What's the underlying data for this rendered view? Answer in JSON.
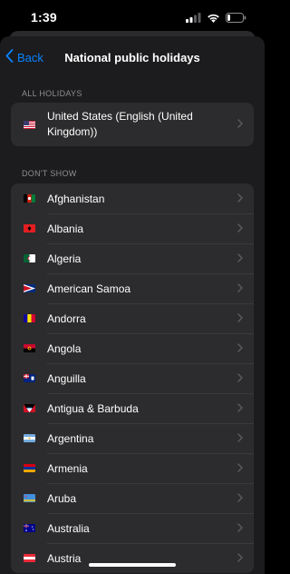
{
  "status_bar": {
    "time": "1:39"
  },
  "nav": {
    "back_label": "Back",
    "title": "National public holidays"
  },
  "sections": {
    "all_holidays": {
      "header": "ALL HOLIDAYS",
      "items": [
        {
          "label": "United States (English (United Kingdom))",
          "flag": "flag-us"
        }
      ]
    },
    "dont_show": {
      "header": "DON'T SHOW",
      "items": [
        {
          "label": "Afghanistan",
          "flag": "flag-af"
        },
        {
          "label": "Albania",
          "flag": "flag-al"
        },
        {
          "label": "Algeria",
          "flag": "flag-dz"
        },
        {
          "label": "American Samoa",
          "flag": "flag-as"
        },
        {
          "label": "Andorra",
          "flag": "flag-ad"
        },
        {
          "label": "Angola",
          "flag": "flag-ao"
        },
        {
          "label": "Anguilla",
          "flag": "flag-ai"
        },
        {
          "label": "Antigua & Barbuda",
          "flag": "flag-ag"
        },
        {
          "label": "Argentina",
          "flag": "flag-ar"
        },
        {
          "label": "Armenia",
          "flag": "flag-am"
        },
        {
          "label": "Aruba",
          "flag": "flag-aw"
        },
        {
          "label": "Australia",
          "flag": "flag-au"
        },
        {
          "label": "Austria",
          "flag": "flag-at"
        }
      ]
    }
  },
  "colors": {
    "accent": "#0a84ff",
    "sheet_bg": "#1c1c1e",
    "cell_bg": "#2c2c2e",
    "secondary_text": "#8e8e93"
  }
}
